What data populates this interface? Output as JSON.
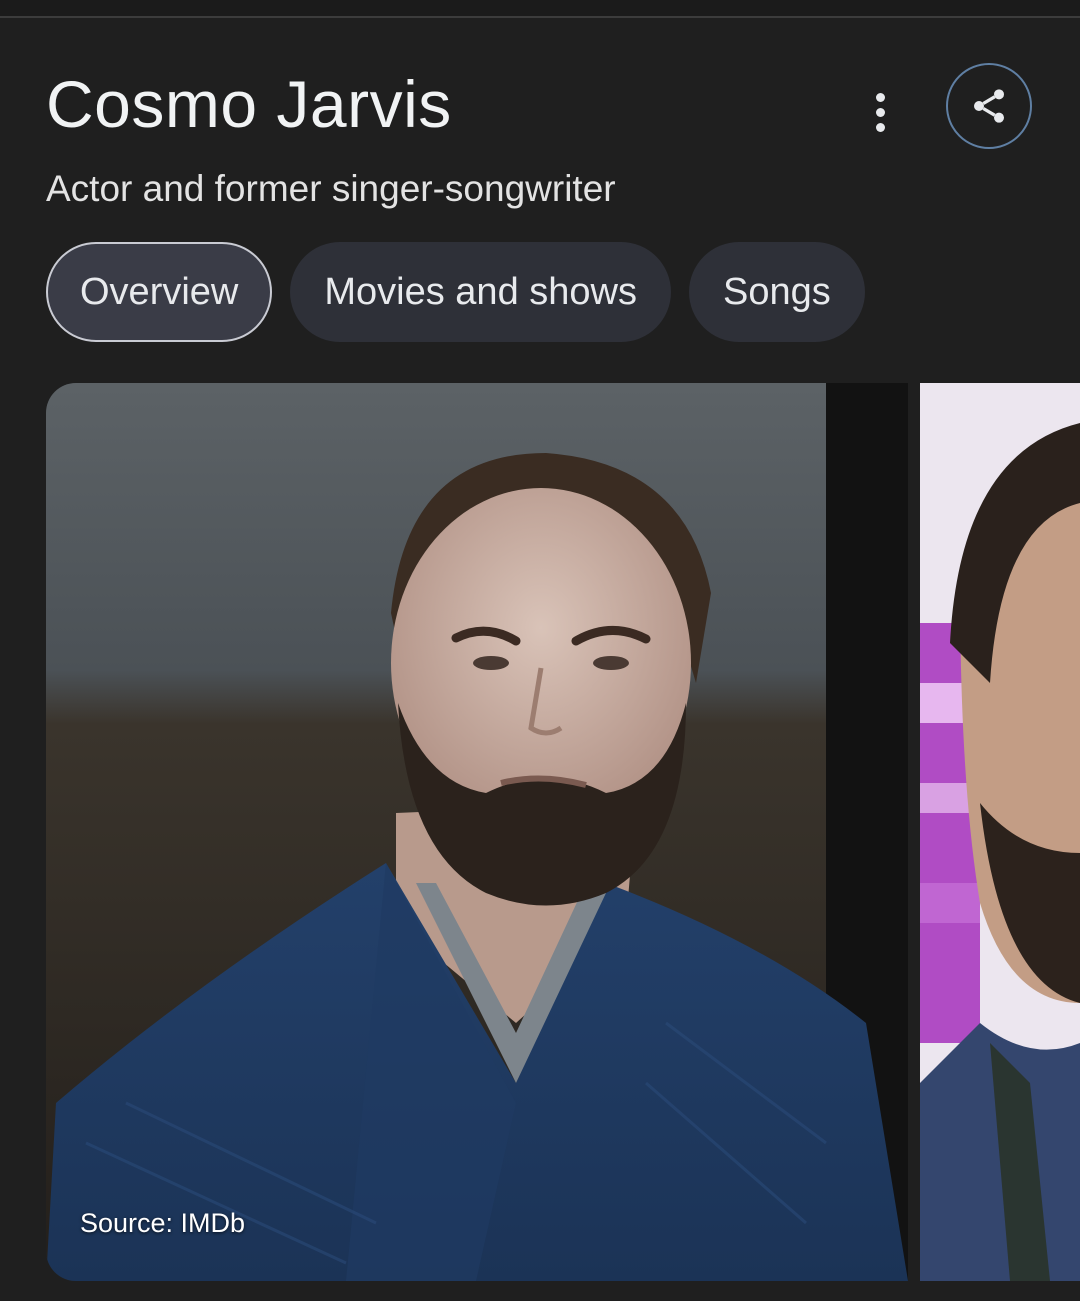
{
  "entity": {
    "name": "Cosmo Jarvis",
    "description": "Actor and former singer-songwriter"
  },
  "actions": {
    "more_icon": "more-vert-icon",
    "share_icon": "share-icon"
  },
  "tabs": [
    {
      "label": "Overview",
      "selected": true
    },
    {
      "label": "Movies and shows",
      "selected": false
    },
    {
      "label": "Songs",
      "selected": false
    }
  ],
  "images": {
    "main_source": "Source: IMDb"
  },
  "colors": {
    "background": "#1f1f1f",
    "chip_background": "#2e3038",
    "chip_selected_border": "#c9cbd3",
    "share_border": "#5f7fa3"
  }
}
